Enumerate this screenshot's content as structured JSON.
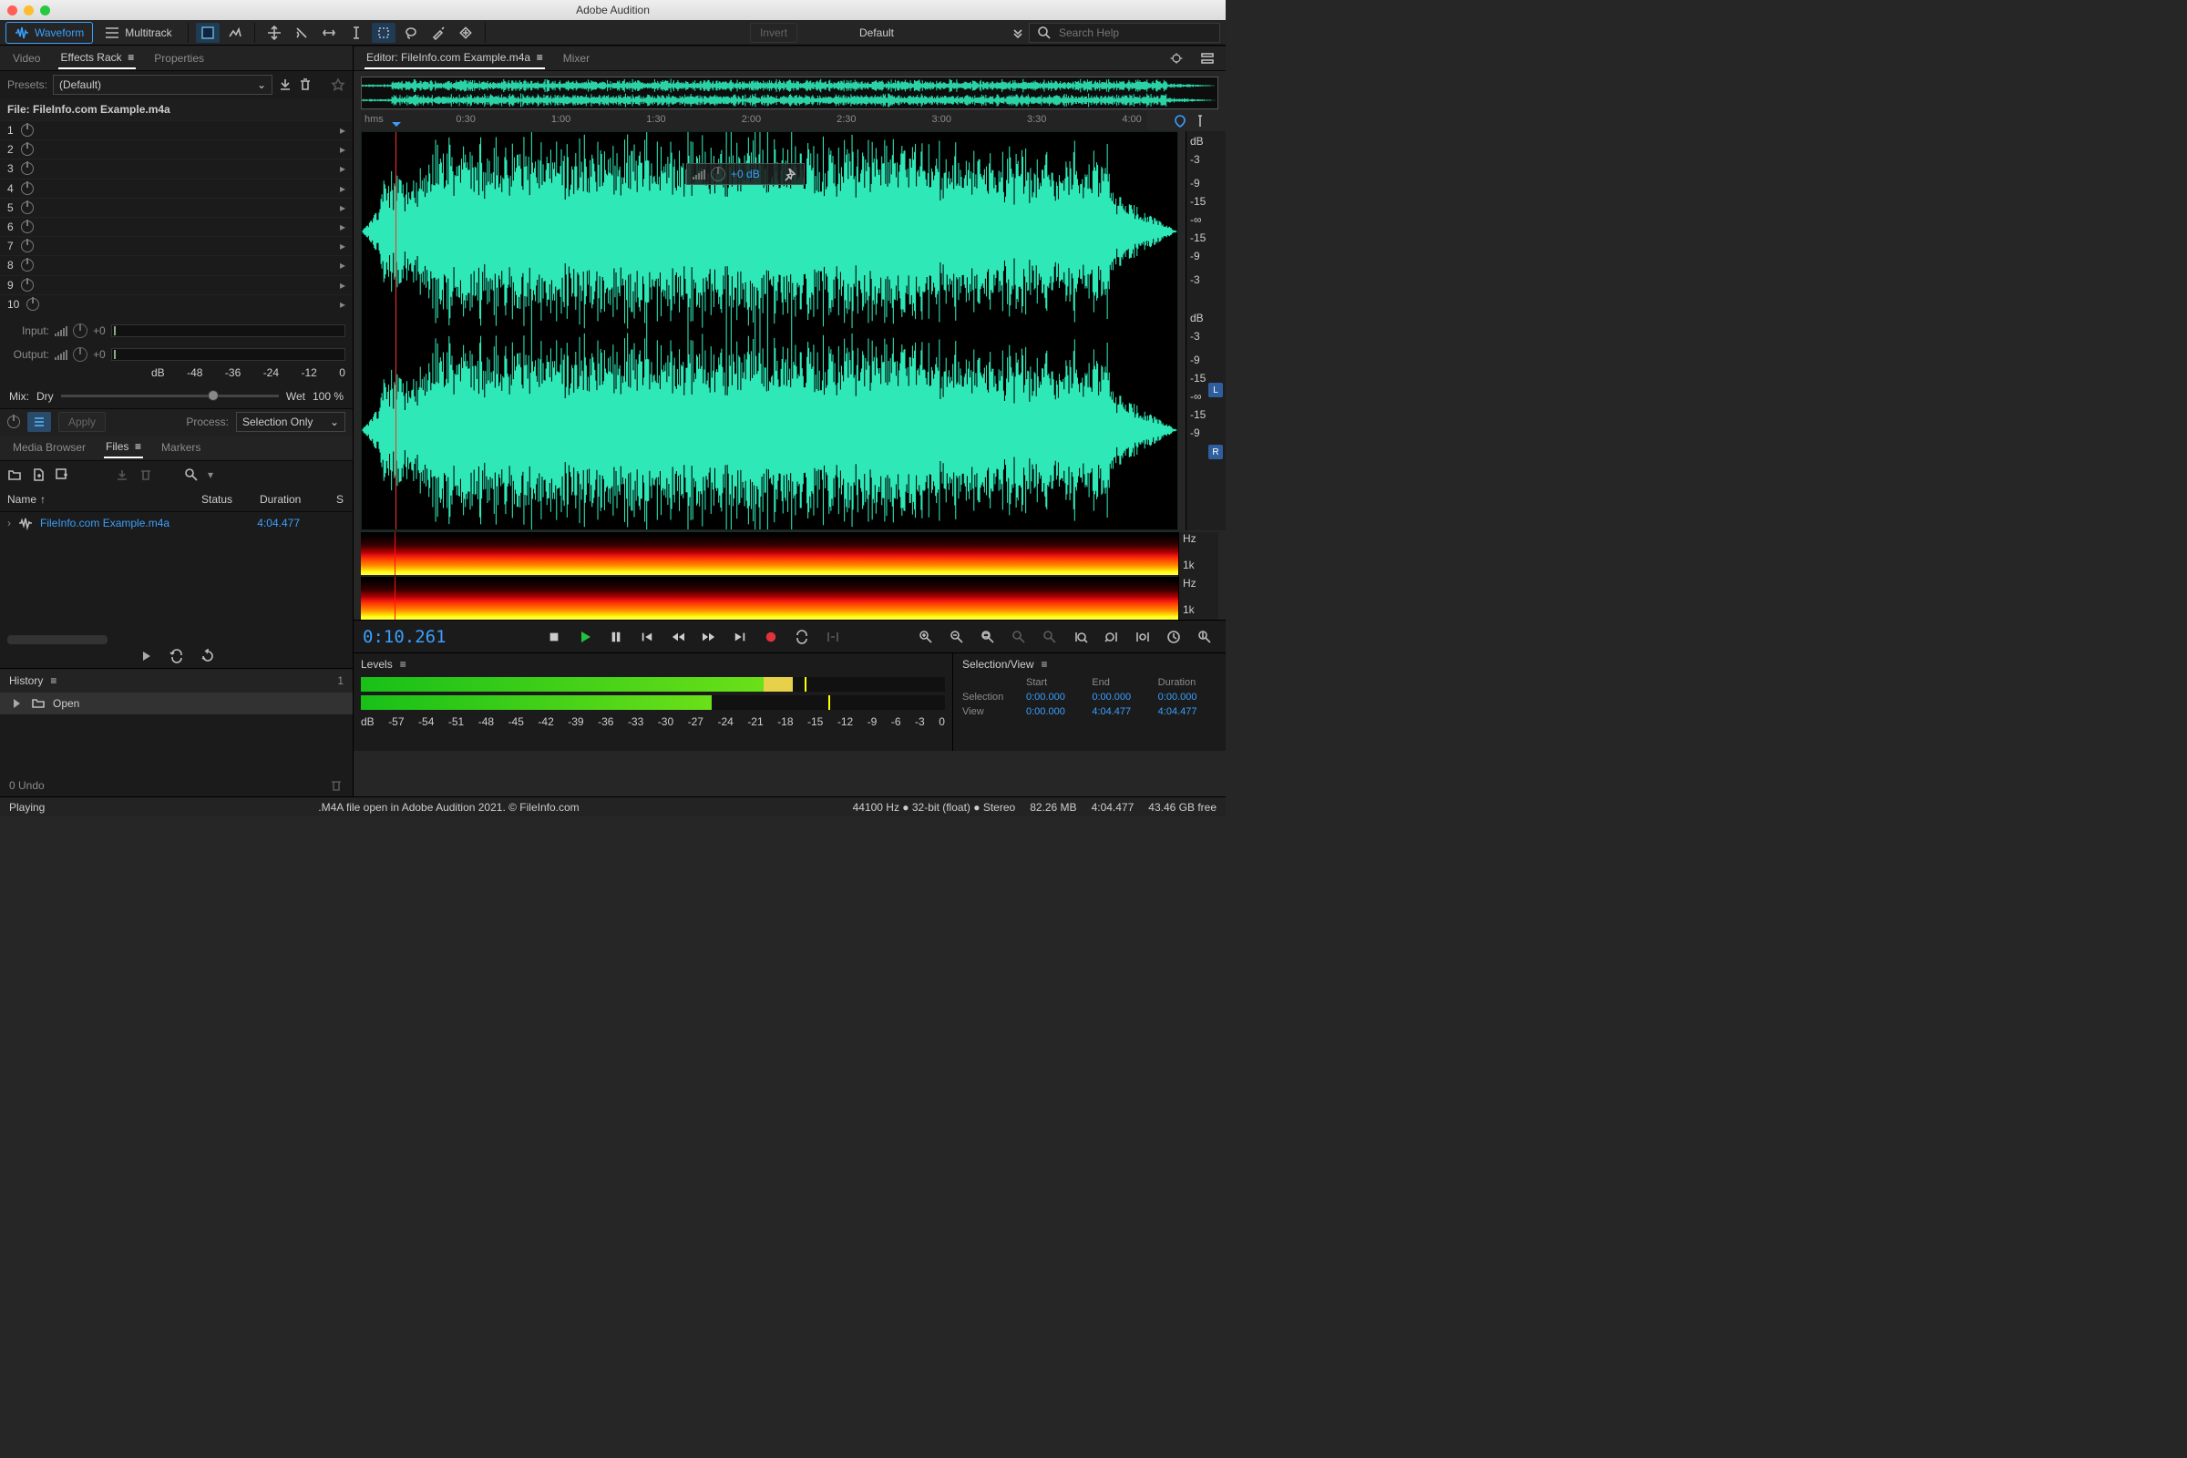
{
  "app": {
    "title": "Adobe Audition"
  },
  "modes": {
    "waveform": "Waveform",
    "multitrack": "Multitrack"
  },
  "toolbar": {
    "invert": "Invert",
    "workspace": "Default",
    "searchPlaceholder": "Search Help"
  },
  "left": {
    "tabs": {
      "video": "Video",
      "effects": "Effects Rack",
      "properties": "Properties"
    },
    "presetsLabel": "Presets:",
    "presetValue": "(Default)",
    "fileLabel": "File: FileInfo.com Example.m4a",
    "slots": [
      "1",
      "2",
      "3",
      "4",
      "5",
      "6",
      "7",
      "8",
      "9",
      "10"
    ],
    "input": "Input:",
    "output": "Output:",
    "ioGain": "+0",
    "dbticks": [
      "dB",
      "-48",
      "-36",
      "-24",
      "-12",
      "0"
    ],
    "mix": "Mix:",
    "dry": "Dry",
    "wet": "Wet",
    "pct": "100 %",
    "apply": "Apply",
    "processLabel": "Process:",
    "processValue": "Selection Only",
    "browserTabs": {
      "media": "Media Browser",
      "files": "Files",
      "markers": "Markers"
    },
    "cols": {
      "name": "Name",
      "status": "Status",
      "duration": "Duration",
      "s": "S"
    },
    "file": {
      "name": "FileInfo.com Example.m4a",
      "duration": "4:04.477"
    },
    "history": "History",
    "historyItem": "Open",
    "undo": "0 Undo",
    "one": "1"
  },
  "editor": {
    "tab": "Editor: FileInfo.com Example.m4a",
    "mixer": "Mixer",
    "ruler": {
      "unit": "hms",
      "marks": [
        "0:30",
        "1:00",
        "1:30",
        "2:00",
        "2:30",
        "3:00",
        "3:30",
        "4:00"
      ]
    },
    "hud": "+0 dB",
    "db": {
      "unit": "dB",
      "ticks": [
        "-3",
        "",
        "-9",
        "-15",
        "-∞",
        "-15",
        "-9",
        "",
        "-3"
      ]
    },
    "hz": {
      "unit": "Hz",
      "tick": "1k"
    },
    "L": "L",
    "R": "R",
    "timecode": "0:10.261"
  },
  "levels": {
    "title": "Levels",
    "scale": [
      "dB",
      "-57",
      "-54",
      "-51",
      "-48",
      "-45",
      "-42",
      "-39",
      "-36",
      "-33",
      "-30",
      "-27",
      "-24",
      "-21",
      "-18",
      "-15",
      "-12",
      "-9",
      "-6",
      "-3",
      "0"
    ]
  },
  "selview": {
    "title": "Selection/View",
    "cols": [
      "Start",
      "End",
      "Duration"
    ],
    "rows": [
      {
        "k": "Selection",
        "a": "0:00.000",
        "b": "0:00.000",
        "c": "0:00.000"
      },
      {
        "k": "View",
        "a": "0:00.000",
        "b": "4:04.477",
        "c": "4:04.477"
      }
    ]
  },
  "status": {
    "state": "Playing",
    "mid": ".M4A file open in Adobe Audition 2021. © FileInfo.com",
    "fmt": "44100 Hz ● 32-bit (float) ● Stereo",
    "mem": "82.26 MB",
    "dur": "4:04.477",
    "disk": "43.46 GB free"
  }
}
